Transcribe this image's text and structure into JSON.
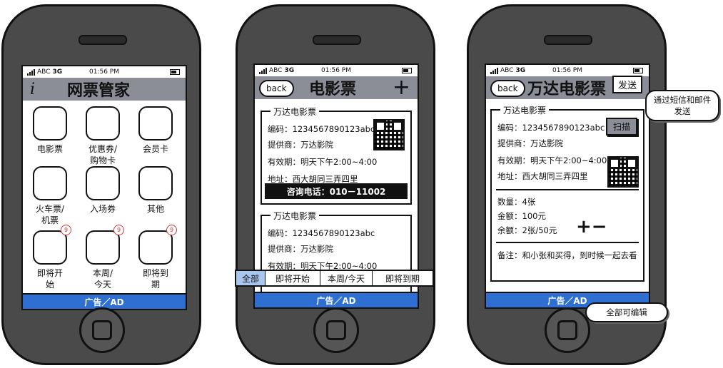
{
  "status_bar": {
    "carrier": "ABC",
    "network": "3G",
    "time": "01:56 PM"
  },
  "phone1": {
    "info_icon": "i",
    "title": "网票管家",
    "apps": [
      {
        "label": "电影票",
        "badge": ""
      },
      {
        "label": "优惠券/购物卡",
        "badge": ""
      },
      {
        "label": "会员卡",
        "badge": ""
      },
      {
        "label": "火车票/机票",
        "badge": ""
      },
      {
        "label": "入场券",
        "badge": ""
      },
      {
        "label": "其他",
        "badge": ""
      },
      {
        "label": "即将开始",
        "badge": "9"
      },
      {
        "label": "本周/今天",
        "badge": "9"
      },
      {
        "label": "即将到期",
        "badge": "9"
      }
    ],
    "ad": "广告／AD"
  },
  "phone2": {
    "back": "back",
    "title": "电影票",
    "add_icon": "+",
    "card1": {
      "legend": "万达电影票",
      "code": "编码：1234567890123abc",
      "provider": "提供商：万达影院",
      "validity": "有效期：明天下午2:00~4:00",
      "address": "地址：西大胡同三弄四里",
      "call_btn": "咨询电话：010－11002"
    },
    "card2": {
      "legend": "万达电影票",
      "code": "编码：1234567890123abc",
      "provider": "提供商：万达影院",
      "validity": "有效期：明天下午2:00~4:00"
    },
    "tabs": [
      "全部",
      "即将开始",
      "本周/今天",
      "即将到期"
    ],
    "ad": "广告／AD"
  },
  "phone3": {
    "back": "back",
    "title": "万达电影票",
    "send_btn": "发送",
    "send_note": "通过短信和邮件发送",
    "card": {
      "legend": "万达电影票",
      "code": "编码：1234567890123abc",
      "scan_btn": "扫描",
      "provider": "提供商：万达影院",
      "validity": "有效期：明天下午2:00~4:00",
      "address": "地址：西大胡同三弄四里",
      "quantity": "数量：4张",
      "amount": "金额：100元",
      "balance": "余额：2张/50元",
      "plus_minus": "+−",
      "note": "备注：和小张和买得，到时候一起去看"
    },
    "ad": "广告／AD",
    "edit_note": "全部可编辑"
  }
}
